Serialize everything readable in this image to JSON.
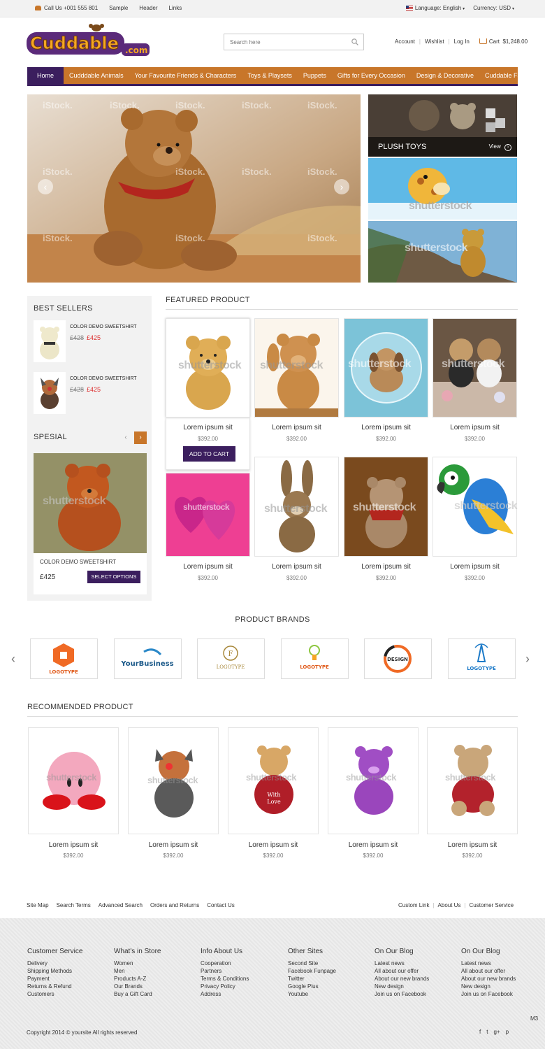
{
  "topbar": {
    "phone": "Call Us +001 555 801",
    "links": [
      "Sample",
      "Header",
      "Links"
    ],
    "language": "Language: English",
    "currency": "Currency: USD"
  },
  "header": {
    "logo_text": "Cuddable",
    "logo_suffix": ".com",
    "search_placeholder": "Search here",
    "account": "Account",
    "wishlist": "Wishlist",
    "login": "Log In",
    "cart_label": "Cart",
    "cart_total": "$1,248.00"
  },
  "nav": [
    "Home",
    "Cudddable Animals",
    "Your Favourite Friends & Characters",
    "Toys & Playsets",
    "Puppets",
    "Gifts for Every Occasion",
    "Design & Decorative",
    "Cuddable Fashion"
  ],
  "hero": {
    "watermark": "iStock.",
    "side_watermark": "shutterstock",
    "plush_title": "PLUSH TOYS",
    "plush_link": "View"
  },
  "sidebar": {
    "best_sellers_title": "BEST SELLERS",
    "items": [
      {
        "name": "COLOR DEMO SWEETSHIRT",
        "old_price": "£428",
        "price": "£425"
      },
      {
        "name": "COLOR DEMO SWEETSHIRT",
        "old_price": "£428",
        "price": "£425"
      }
    ],
    "special_title": "SPESIAL",
    "special_name": "COLOR DEMO SWEETSHIRT",
    "special_price": "£425",
    "special_button": "SELECT OPTIONS"
  },
  "featured": {
    "title": "FEATURED PRODUCT",
    "add_to_cart": "ADD TO CART",
    "products": [
      {
        "name": "Lorem ipsum sit",
        "price": "$392.00"
      },
      {
        "name": "Lorem ipsum sit",
        "price": "$392.00"
      },
      {
        "name": "Lorem ipsum sit",
        "price": "$392.00"
      },
      {
        "name": "Lorem ipsum sit",
        "price": "$392.00"
      },
      {
        "name": "Lorem ipsum sit",
        "price": "$392.00"
      },
      {
        "name": "Lorem ipsum sit",
        "price": "$392.00"
      },
      {
        "name": "Lorem ipsum sit",
        "price": "$392.00"
      },
      {
        "name": "Lorem ipsum sit",
        "price": "$392.00"
      }
    ]
  },
  "brands": {
    "title": "PRODUCT BRANDS",
    "logos": [
      "LOGOTYPE",
      "YourBusiness",
      "LOGOTYPE",
      "LOGOTYPE",
      "DESIGN",
      "LOGOTYPE"
    ]
  },
  "recommended": {
    "title": "RECOMMENDED  PRODUCT",
    "products": [
      {
        "name": "Lorem ipsum sit",
        "price": "$392.00"
      },
      {
        "name": "Lorem ipsum sit",
        "price": "$392.00"
      },
      {
        "name": "Lorem ipsum sit",
        "price": "$392.00"
      },
      {
        "name": "Lorem ipsum sit",
        "price": "$392.00"
      },
      {
        "name": "Lorem ipsum sit",
        "price": "$392.00"
      }
    ]
  },
  "footer_links_left": [
    "Site Map",
    "Search Terms",
    "Advanced Search",
    "Orders and Returns",
    "Contact Us"
  ],
  "footer_links_right": [
    "Custom Link",
    "About Us",
    "Customer Service"
  ],
  "footer_columns": [
    {
      "title": "Customer Service",
      "links": [
        "Delivery",
        "Shipping Methods",
        "Payment",
        "Returns & Refund",
        "Customers"
      ]
    },
    {
      "title": "What's in Store",
      "links": [
        "Women",
        "Men",
        "Products A-Z",
        "Our Brands",
        "Buy a Gift Card"
      ]
    },
    {
      "title": "Info About Us",
      "links": [
        "Cooperation",
        "Partners",
        "Terms & Conditions",
        "Privacy Policy",
        "Address"
      ]
    },
    {
      "title": "Other Sites",
      "links": [
        "Second Site",
        "Facebook Funpage",
        "Twitter",
        "Google Plus",
        "Youtube"
      ]
    },
    {
      "title": "On Our Blog",
      "links": [
        "Latest news",
        "All about our offer",
        "About our new brands",
        "New design",
        "Join us on Facebook"
      ]
    },
    {
      "title": "On Our Blog",
      "links": [
        "Latest news",
        "All about our offer",
        "About our new brands",
        "New design",
        "Join us on Facebook"
      ]
    }
  ],
  "copyright": "Copyright 2014 © yoursite All rights reserved",
  "m3": "M3",
  "social": [
    "f",
    "t",
    "g+",
    "p"
  ],
  "colors": {
    "accent": "#c8762a",
    "dark": "#3b1e5e",
    "sale": "#dd3333"
  }
}
